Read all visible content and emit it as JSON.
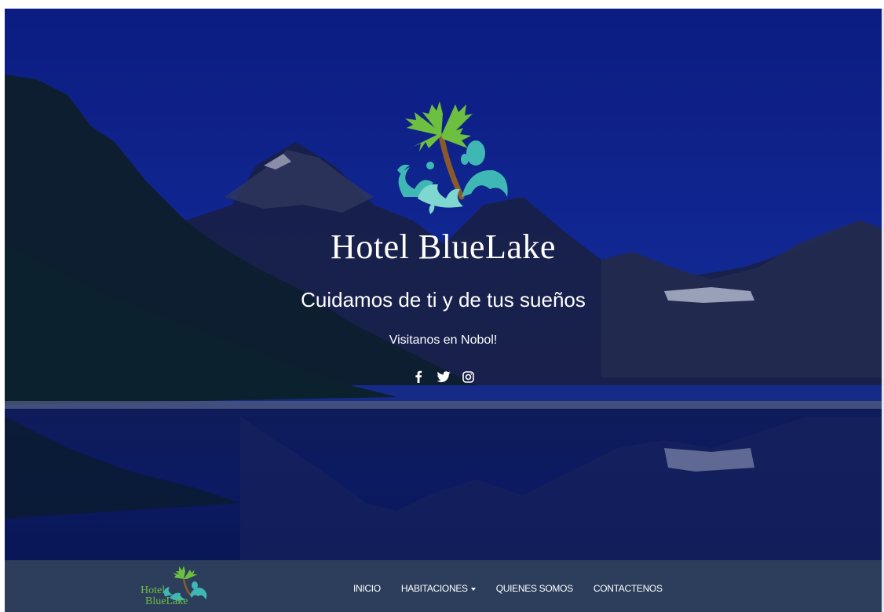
{
  "hero": {
    "title": "Hotel BlueLake",
    "tagline": "Cuidamos de ti y de tus sueños",
    "visit": "Visitanos en Nobol!",
    "social_icons": [
      "facebook-icon",
      "twitter-icon",
      "instagram-icon"
    ]
  },
  "navbar": {
    "logo_line1": "Hotel",
    "logo_line2": "BlueLake",
    "items": [
      {
        "label": "INICIO"
      },
      {
        "label": "HABITACIONES"
      },
      {
        "label": "QUIENES SOMOS"
      },
      {
        "label": "CONTACTENOS"
      }
    ]
  },
  "colors": {
    "navbar_bg": "#2c3e5c",
    "sky": "#0d1f8a",
    "palm_leaf": "#6dbf3f",
    "splash": "#3fb8b5",
    "trunk": "#8b5a2b"
  }
}
